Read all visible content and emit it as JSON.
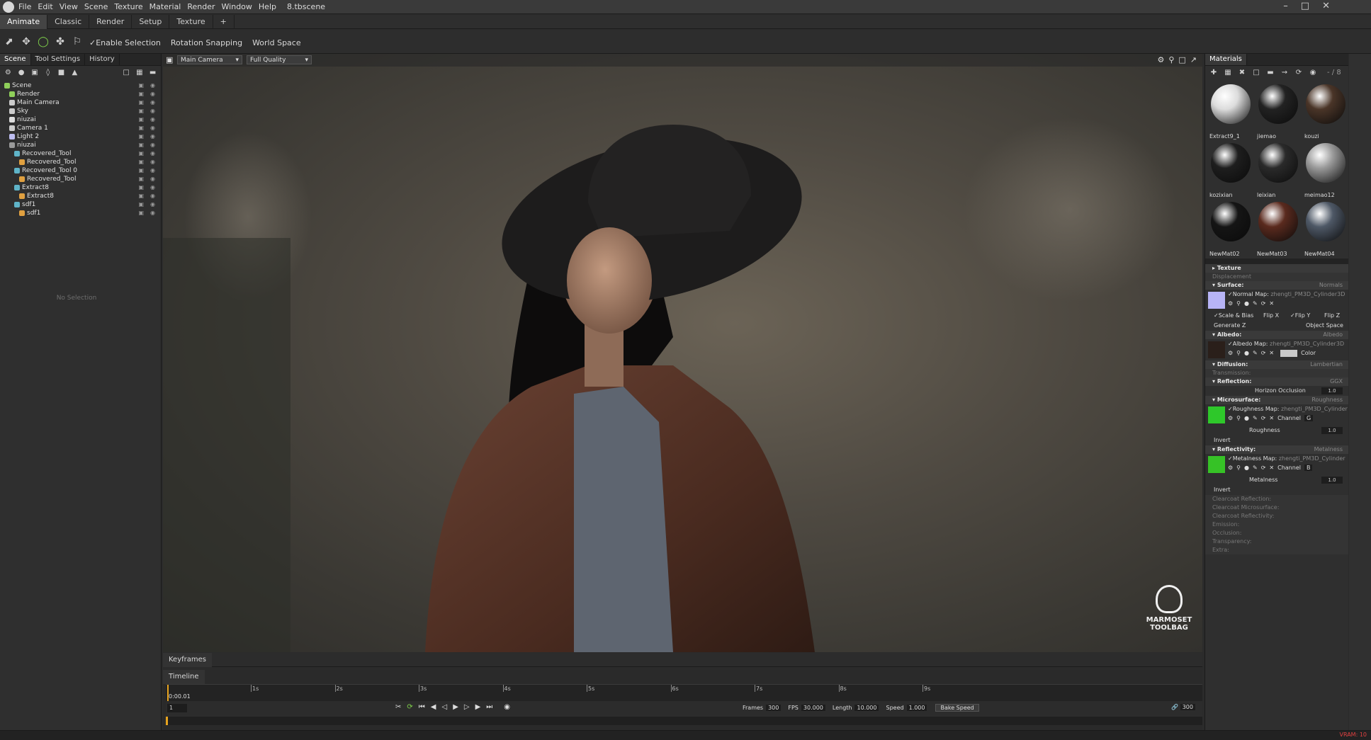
{
  "titlebar": {
    "menus": [
      "File",
      "Edit",
      "View",
      "Scene",
      "Texture",
      "Material",
      "Render",
      "Window",
      "Help"
    ],
    "document": "8.tbscene"
  },
  "modes": [
    "Animate",
    "Classic",
    "Render",
    "Setup",
    "Texture",
    "+"
  ],
  "toolbar": {
    "enable_selection": "Enable Selection",
    "rotation_snapping": "Rotation Snapping",
    "world_space": "World Space"
  },
  "left": {
    "tabs": [
      "Scene",
      "Tool Settings",
      "History"
    ],
    "tree": [
      {
        "label": "Scene",
        "depth": 0,
        "color": "#8fcf5a"
      },
      {
        "label": "Render",
        "depth": 1,
        "color": "#8fcf5a"
      },
      {
        "label": "Main Camera",
        "depth": 1,
        "color": "#cccccc"
      },
      {
        "label": "Sky",
        "depth": 1,
        "color": "#cccccc"
      },
      {
        "label": "niuzai",
        "depth": 1,
        "color": "#dddddd"
      },
      {
        "label": "Camera 1",
        "depth": 1,
        "color": "#cccccc"
      },
      {
        "label": "Light 2",
        "depth": 1,
        "color": "#bdbdf0"
      },
      {
        "label": "niuzai",
        "depth": 1,
        "color": "#9a9a9a"
      },
      {
        "label": "Recovered_Tool",
        "depth": 2,
        "color": "#5fb4c8"
      },
      {
        "label": "Recovered_Tool",
        "depth": 3,
        "color": "#e0a040"
      },
      {
        "label": "Recovered_Tool 0",
        "depth": 2,
        "color": "#5fb4c8"
      },
      {
        "label": "Recovered_Tool",
        "depth": 3,
        "color": "#e0a040"
      },
      {
        "label": "Extract8",
        "depth": 2,
        "color": "#5fb4c8"
      },
      {
        "label": "Extract8",
        "depth": 3,
        "color": "#e0a040"
      },
      {
        "label": "sdf1",
        "depth": 2,
        "color": "#5fb4c8"
      },
      {
        "label": "sdf1",
        "depth": 3,
        "color": "#e0a040"
      }
    ],
    "no_selection": "No Selection"
  },
  "viewport": {
    "camera": "Main Camera",
    "quality": "Full Quality",
    "watermark_line1": "MARMOSET",
    "watermark_line2": "TOOLBAG"
  },
  "bottom": {
    "keyframes": "Keyframes",
    "timeline": "Timeline",
    "time": "0:00.01",
    "ticks": [
      "1s",
      "2s",
      "3s",
      "4s",
      "5s",
      "6s",
      "7s",
      "8s",
      "9s"
    ],
    "frame": "1",
    "frames_label": "Frames",
    "frames_value": "300",
    "fps_label": "FPS",
    "fps_value": "30.000",
    "length_label": "Length",
    "length_value": "10.000",
    "speed_label": "Speed",
    "speed_value": "1.000",
    "bake_speed": "Bake Speed",
    "end_frame": "300"
  },
  "right": {
    "title": "Materials",
    "slot": "- / 8",
    "materials": [
      {
        "name": "Extract9_1",
        "color": "#dcdcdc"
      },
      {
        "name": "jiemao",
        "color": "#222222"
      },
      {
        "name": "kouzi",
        "color": "#4a3528"
      },
      {
        "name": "kozixian",
        "color": "#1e1e1e"
      },
      {
        "name": "leixian",
        "color": "#2a2a2a"
      },
      {
        "name": "meimao12",
        "color": "#9a9a9a"
      },
      {
        "name": "NewMat02",
        "color": "#151515"
      },
      {
        "name": "NewMat03",
        "color": "#5a2a1e"
      },
      {
        "name": "NewMat04",
        "color": "#4e5866"
      }
    ],
    "sections": {
      "texture": "Texture",
      "displacement": "Displacement",
      "surface": "Surface:",
      "surface_val": "Normals",
      "normal_map": "Normal Map:",
      "normal_file": "zhengti_PM3D_Cylinder3D",
      "scale_bias": "Scale & Bias",
      "flip_x": "Flip X",
      "flip_y": "Flip Y",
      "flip_z": "Flip Z",
      "generate_z": "Generate Z",
      "object_space": "Object Space",
      "albedo": "Albedo:",
      "albedo_val": "Albedo",
      "albedo_map": "Albedo Map:",
      "albedo_file": "zhengti_PM3D_Cylinder3D",
      "color": "Color",
      "diffusion": "Diffusion:",
      "diffusion_val": "Lambertian",
      "transmission": "Transmission:",
      "reflection": "Reflection:",
      "reflection_val": "GGX",
      "horizon": "Horizon Occlusion",
      "horizon_val": "1.0",
      "microsurface": "Microsurface:",
      "microsurface_val": "Roughness",
      "roughness_map": "Roughness Map:",
      "roughness_file": "zhengti_PM3D_Cylinder",
      "channel": "Channel",
      "channel_g": "G",
      "roughness": "Roughness",
      "roughness_val": "1.0",
      "invert": "Invert",
      "reflectivity": "Reflectivity:",
      "reflectivity_val": "Metalness",
      "metalness_map": "Metalness Map:",
      "metalness_file": "zhengti_PM3D_Cylinder",
      "channel_b": "B",
      "metalness": "Metalness",
      "metalness_val": "1.0",
      "invert2": "Invert",
      "others": [
        "Clearcoat Reflection:",
        "Clearcoat Microsurface:",
        "Clearcoat Reflectivity:",
        "Emission:",
        "Occlusion:",
        "Transparency:",
        "Extra:"
      ]
    }
  },
  "status": {
    "vram": "VRAM: 10"
  }
}
